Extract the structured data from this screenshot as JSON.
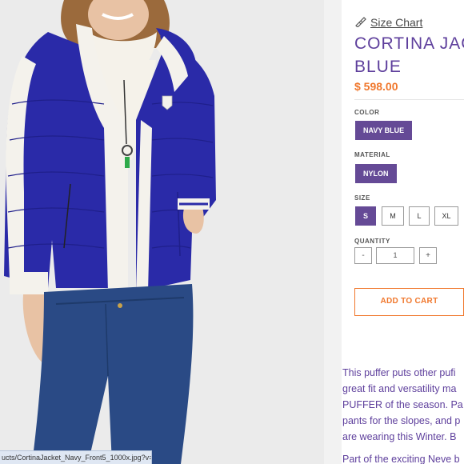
{
  "product": {
    "size_chart_label": "Size Chart",
    "title_line1": "CORTINA JAC",
    "title_line2": "BLUE",
    "price": "$ 598.00"
  },
  "options": {
    "color_label": "COLOR",
    "color_value": "NAVY BLUE",
    "material_label": "MATERIAL",
    "material_value": "NYLON",
    "size_label": "SIZE",
    "sizes": [
      "S",
      "M",
      "L",
      "XL"
    ],
    "selected_size": "S",
    "quantity_label": "QUANTITY",
    "quantity_minus": "-",
    "quantity_value": "1",
    "quantity_plus": "+"
  },
  "cart": {
    "add_label": "ADD TO CART"
  },
  "description": {
    "lines": [
      "This puffer puts other pufi",
      "great fit and versatility ma",
      "PUFFER of the season. Pa",
      "pants for the slopes, and p",
      "are wearing this Winter. B"
    ],
    "line2": "Part of the exciting Neve b"
  },
  "status_bar": {
    "url": "ucts/CortinaJacket_Navy_Front5_1000x.jpg?v=..."
  },
  "colors": {
    "accent_purple": "#654a96",
    "title_purple": "#5e3f9c",
    "price_orange": "#f0772c",
    "jacket_blue": "#2a2aa8"
  }
}
